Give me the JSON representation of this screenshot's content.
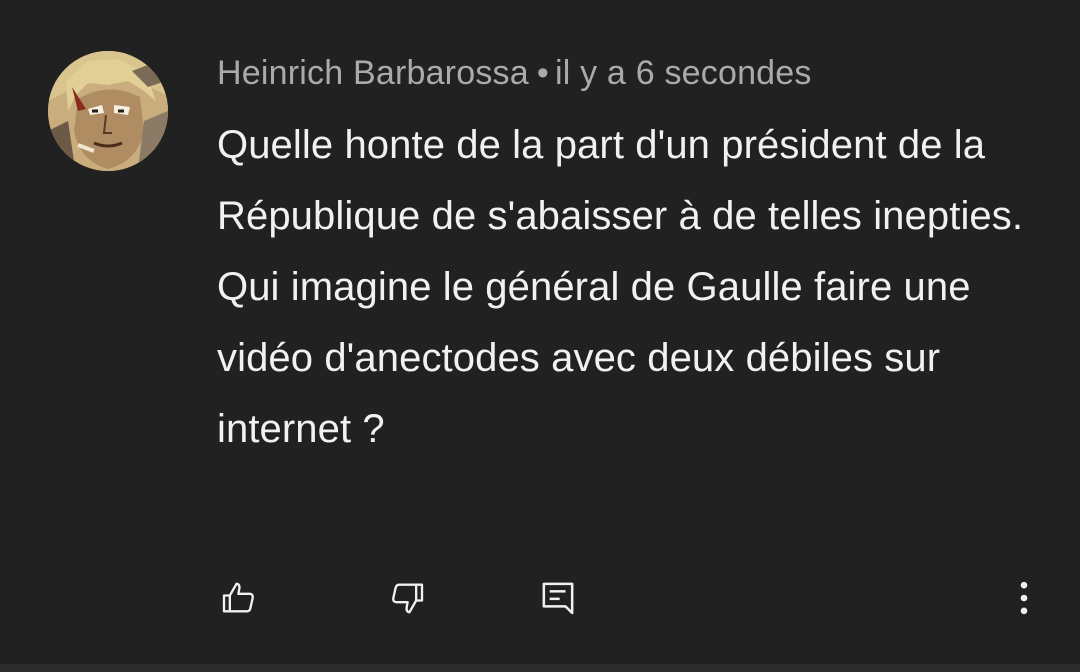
{
  "comment": {
    "author": "Heinrich Barbarossa",
    "separator": "•",
    "time": "il y a 6 secondes",
    "paragraphs": [
      "Quelle honte de la part d'un président de la République de s'abaisser à de telles inepties.",
      "Qui imagine le général de Gaulle faire une vidéo d'anectodes avec deux débiles sur internet ?"
    ]
  },
  "icons": {
    "like": "thumbs-up-icon",
    "dislike": "thumbs-down-icon",
    "reply": "comment-reply-icon",
    "more": "more-vertical-icon"
  },
  "colors": {
    "background": "#212121",
    "text_primary": "#f1f1f1",
    "text_secondary": "#aaaaaa"
  }
}
